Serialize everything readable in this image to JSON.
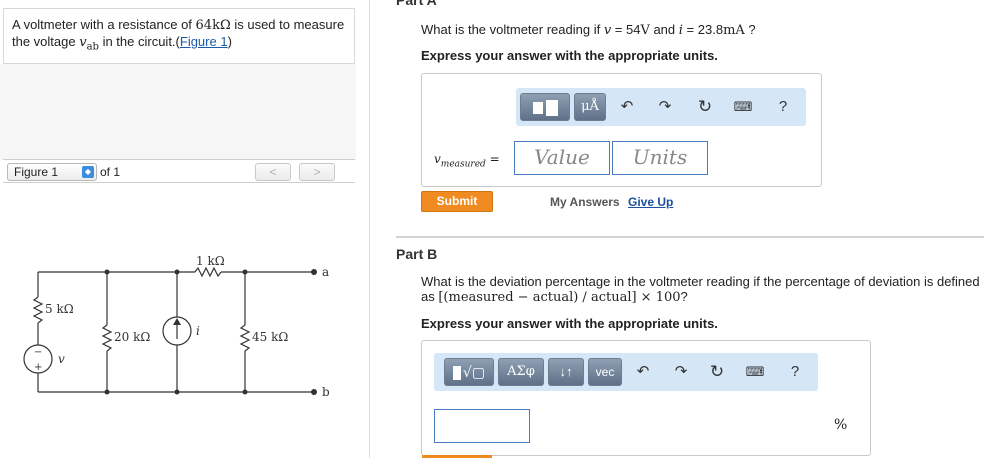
{
  "problem": {
    "text_prefix": "A voltmeter with a resistance of ",
    "resistance": "64kΩ",
    "text_mid": " is used to measure the voltage ",
    "voltage_symbol": "v",
    "voltage_sub": "ab",
    "text_suffix": " in the circuit.(",
    "figure_link": "Figure 1",
    "close_paren": ")"
  },
  "figure_nav": {
    "select_value": "Figure 1",
    "of_text": "of 1",
    "prev": "<",
    "next": ">"
  },
  "circuit": {
    "r_series": "1 kΩ",
    "r_source": "5 kΩ",
    "r_shunt1": "20 kΩ",
    "r_shunt2": "45 kΩ",
    "source_v": "v",
    "source_i": "i",
    "terminal_a": "a",
    "terminal_b": "b",
    "plus": "+",
    "minus": "−"
  },
  "part_a": {
    "title": "Part A",
    "question_prefix": "What is the voltmeter reading if ",
    "v_sym": "v",
    "v_eq": " = 54",
    "v_unit": "V",
    "and": " and ",
    "i_sym": "i",
    "i_eq": " = 23.8",
    "i_unit": "mA",
    "question_suffix": " ?",
    "instruction": "Express your answer with the appropriate units.",
    "toolbar": {
      "units_btn": "μÅ",
      "help": "?"
    },
    "var_label": "v",
    "var_sub": "measured",
    "eq": "=",
    "value_placeholder": "Value",
    "units_placeholder": "Units",
    "submit": "Submit",
    "my_answers": "My Answers",
    "give_up": "Give Up"
  },
  "part_b": {
    "title": "Part B",
    "question_line1": "What is the deviation percentage in the voltmeter reading if the percentage of deviation is defined",
    "question_line2_prefix": "as ",
    "formula": "[(measured − actual) / actual] × 100",
    "question_line2_suffix": "?",
    "instruction": "Express your answer with the appropriate units.",
    "toolbar": {
      "greek_btn": "ΑΣφ",
      "arrows_btn": "↓↑",
      "vec_btn": "vec",
      "help": "?"
    },
    "unit_symbol": "%"
  }
}
